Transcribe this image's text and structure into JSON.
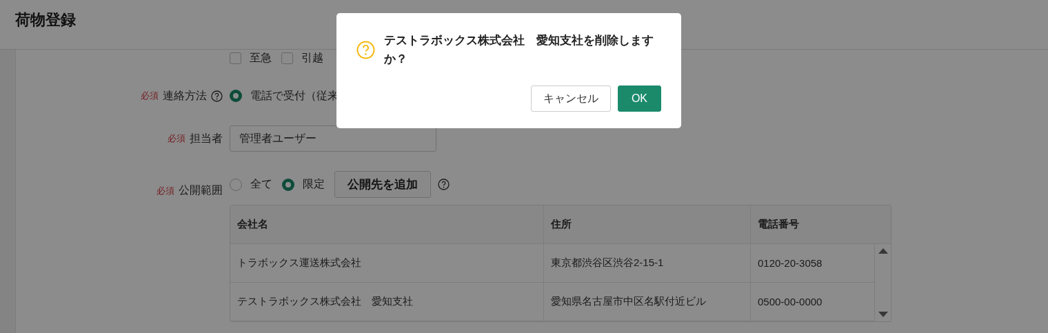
{
  "header": {
    "title": "荷物登録"
  },
  "form": {
    "rows": [
      {
        "kind": "checkboxes",
        "options": [
          {
            "label": "至急",
            "checked": false
          },
          {
            "label": "引越",
            "checked": false
          }
        ]
      },
      {
        "kind": "radios",
        "required": "必須",
        "label": "連絡方法",
        "help": true,
        "options": [
          {
            "label": "電話で受付（従来",
            "selected": true
          }
        ]
      },
      {
        "kind": "text",
        "required": "必須",
        "label": "担当者",
        "value": "管理者ユーザー"
      },
      {
        "kind": "radios",
        "required": "必須",
        "label": "公開範囲",
        "help": false,
        "options": [
          {
            "label": "全て",
            "selected": false
          },
          {
            "label": "限定",
            "selected": true
          }
        ],
        "button": "公開先を追加"
      }
    ]
  },
  "table": {
    "columns": [
      "会社名",
      "住所",
      "電話番号"
    ],
    "rows": [
      [
        "トラボックス運送株式会社",
        "東京都渋谷区渋谷2-15-1",
        "0120-20-3058"
      ],
      [
        "テストラボックス株式会社　愛知支社",
        "愛知県名古屋市中区名駅付近ビル",
        "0500-00-0000"
      ]
    ]
  },
  "dialog": {
    "message": "テストラボックス株式会社　愛知支社を削除しますか？",
    "buttons": [
      {
        "label": "キャンセル",
        "kind": "secondary"
      },
      {
        "label": "OK",
        "kind": "primary"
      }
    ]
  }
}
